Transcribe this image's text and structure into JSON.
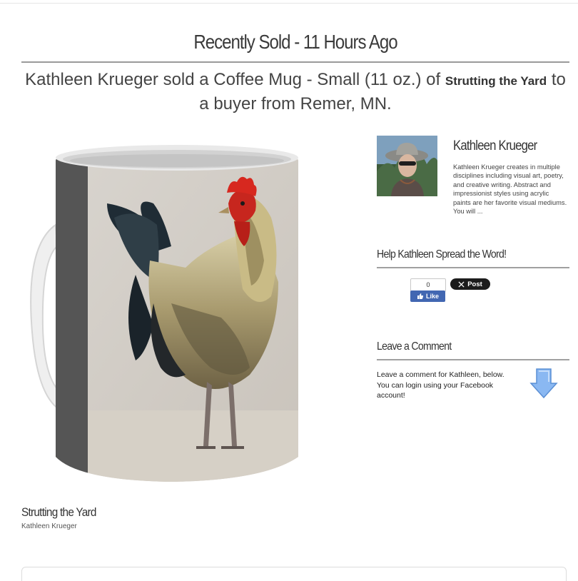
{
  "header": {
    "title": "Recently Sold - 11 Hours Ago"
  },
  "sale": {
    "prefix": "Kathleen Krueger sold a Coffee Mug - Small (11 oz.) of",
    "art_title": "Strutting the Yard",
    "suffix": "to a buyer from Remer, MN."
  },
  "product": {
    "title": "Strutting the Yard",
    "artist": "Kathleen Krueger"
  },
  "artist": {
    "name": "Kathleen Krueger",
    "bio": "Kathleen Krueger creates in multiple disciplines including visual art, poetry, and creative writing. Abstract and impressionist styles using acrylic paints are her favorite visual mediums. You will ..."
  },
  "share": {
    "heading": "Help Kathleen Spread the Word!",
    "fb_count": "0",
    "fb_like_label": "Like",
    "x_post_label": "Post"
  },
  "comment": {
    "heading": "Leave a Comment",
    "text": "Leave a comment for Kathleen, below.   You can login using your Facebook account!"
  },
  "colors": {
    "facebook_blue": "#4267b2",
    "x_black": "#1c1c1c",
    "arrow_blue": "#7fb2f0"
  }
}
